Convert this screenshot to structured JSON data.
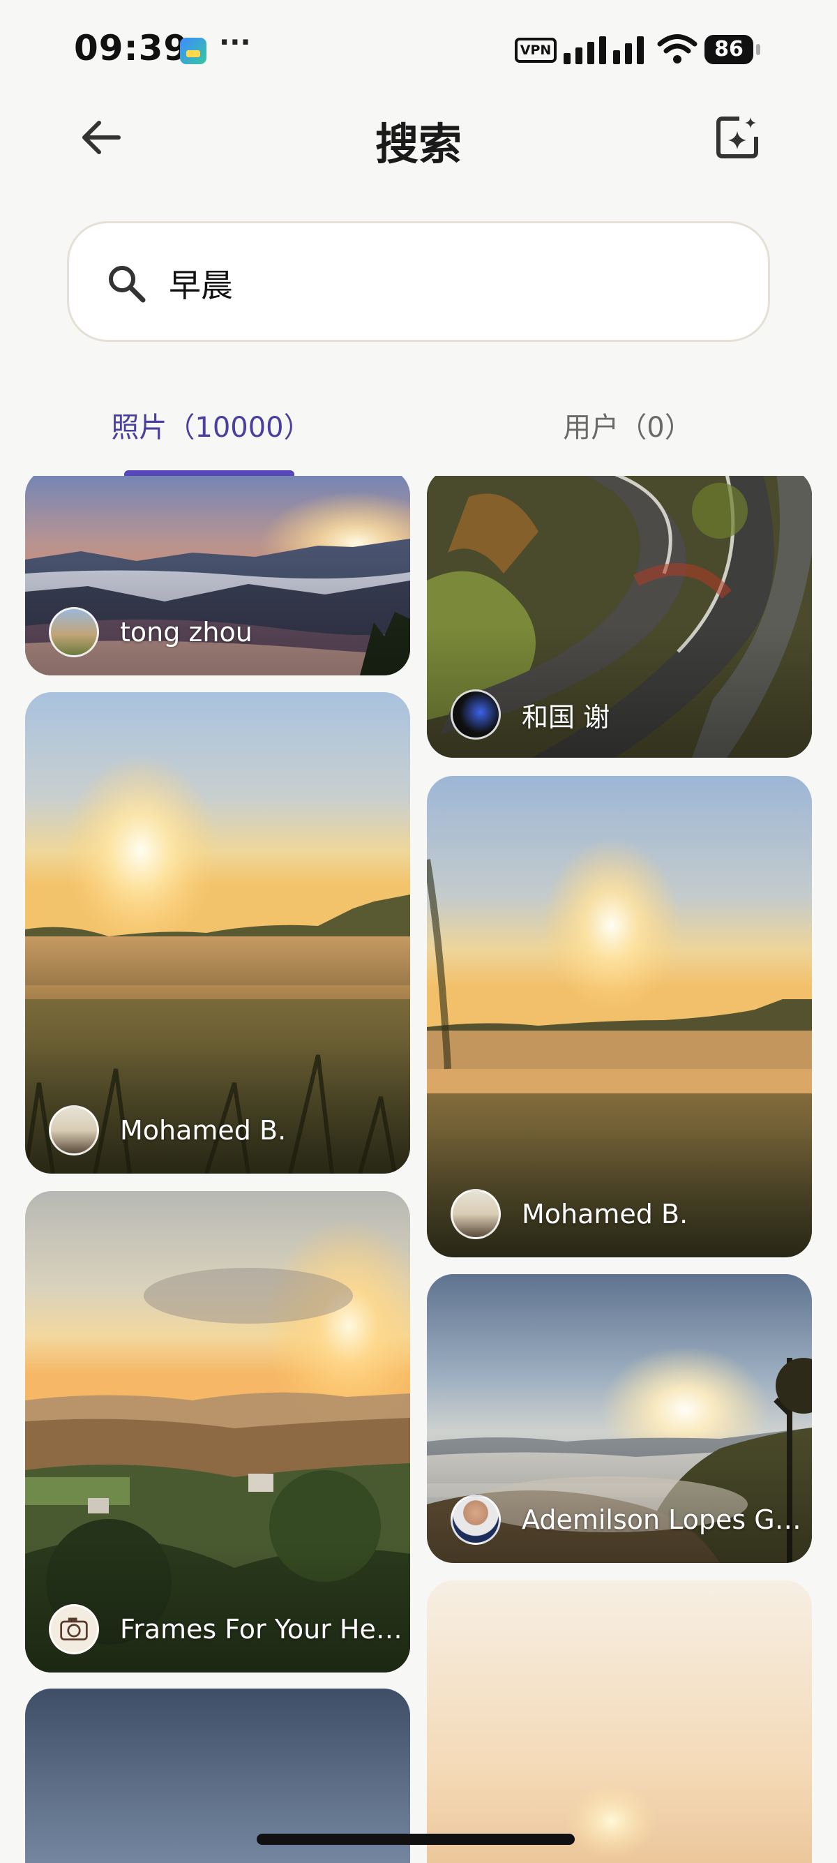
{
  "status_bar": {
    "time": "09:39",
    "more": "···",
    "vpn": "VPN",
    "battery": "86",
    "icons": [
      "app-notification-icon",
      "vpn-icon",
      "signal-icon",
      "wifi-icon",
      "battery-icon"
    ]
  },
  "header": {
    "title": "搜索",
    "back_icon": "arrow-left-icon",
    "action_icon": "ai-image-icon"
  },
  "search": {
    "value": "早晨",
    "icon": "search-icon"
  },
  "tabs": [
    {
      "label": "照片（10000）",
      "selected": true
    },
    {
      "label": "用户（0）",
      "selected": false
    }
  ],
  "colors": {
    "accent": "#5846b8",
    "tab_active_text": "#4a3fa0",
    "background": "#f7f7f5"
  },
  "photos": [
    {
      "author": "tong zhou",
      "scene": "mountains-sea-of-clouds-sunrise"
    },
    {
      "author": "和国 谢",
      "scene": "winding-mountain-road"
    },
    {
      "author": "Mohamed B.",
      "scene": "misty-field-sunrise"
    },
    {
      "author": "Mohamed B.",
      "scene": "misty-field-sunrise"
    },
    {
      "author": "Frames For Your Heart",
      "scene": "valley-village-sunrise"
    },
    {
      "author": "Ademilson Lopes Ga...",
      "scene": "hills-mist-sunrise"
    },
    {
      "author": "",
      "scene": "blue-sky"
    },
    {
      "author": "",
      "scene": "pale-hazy-sunrise"
    }
  ]
}
